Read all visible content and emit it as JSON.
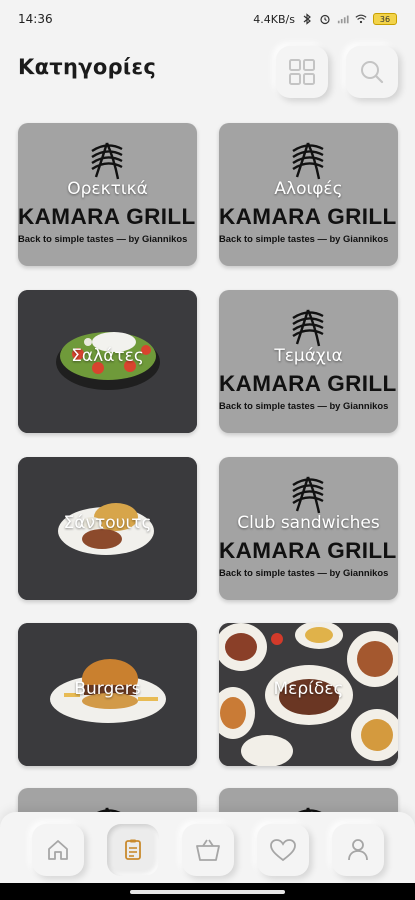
{
  "status_bar": {
    "time": "14:36",
    "network_speed": "4.4KB/s",
    "battery_level": "36",
    "icons": [
      "bluetooth-icon",
      "alarm-icon",
      "signal-icon",
      "wifi-icon",
      "battery-icon"
    ]
  },
  "header": {
    "title": "Κατηγορίες",
    "grid_button_icon": "grid-icon",
    "search_button_icon": "search-icon"
  },
  "brand": {
    "name": "KAMARA GRILL",
    "tagline": "Back to simple tastes — by Giannikos"
  },
  "categories": [
    {
      "label": "Ορεκτικά",
      "image": "logo"
    },
    {
      "label": "Αλοιφές",
      "image": "logo"
    },
    {
      "label": "Σαλάτες",
      "image": "salad-photo"
    },
    {
      "label": "Τεμάχια",
      "image": "logo"
    },
    {
      "label": "Σάντουιτς",
      "image": "sandwich-photo"
    },
    {
      "label": "Club sandwiches",
      "image": "logo"
    },
    {
      "label": "Burgers",
      "image": "burger-photo"
    },
    {
      "label": "Μερίδες",
      "image": "platters-photo"
    },
    {
      "label": "",
      "image": "logo"
    },
    {
      "label": "",
      "image": "logo"
    }
  ],
  "bottom_nav": [
    {
      "icon": "home-icon",
      "active": false
    },
    {
      "icon": "menu-icon",
      "active": true
    },
    {
      "icon": "basket-icon",
      "active": false
    },
    {
      "icon": "heart-icon",
      "active": false
    },
    {
      "icon": "user-icon",
      "active": false
    }
  ],
  "colors": {
    "background": "#f3f3f3",
    "logo_card": "#a3a3a3",
    "active_icon": "#c98a2e",
    "inactive_icon": "#9a9a9a"
  }
}
